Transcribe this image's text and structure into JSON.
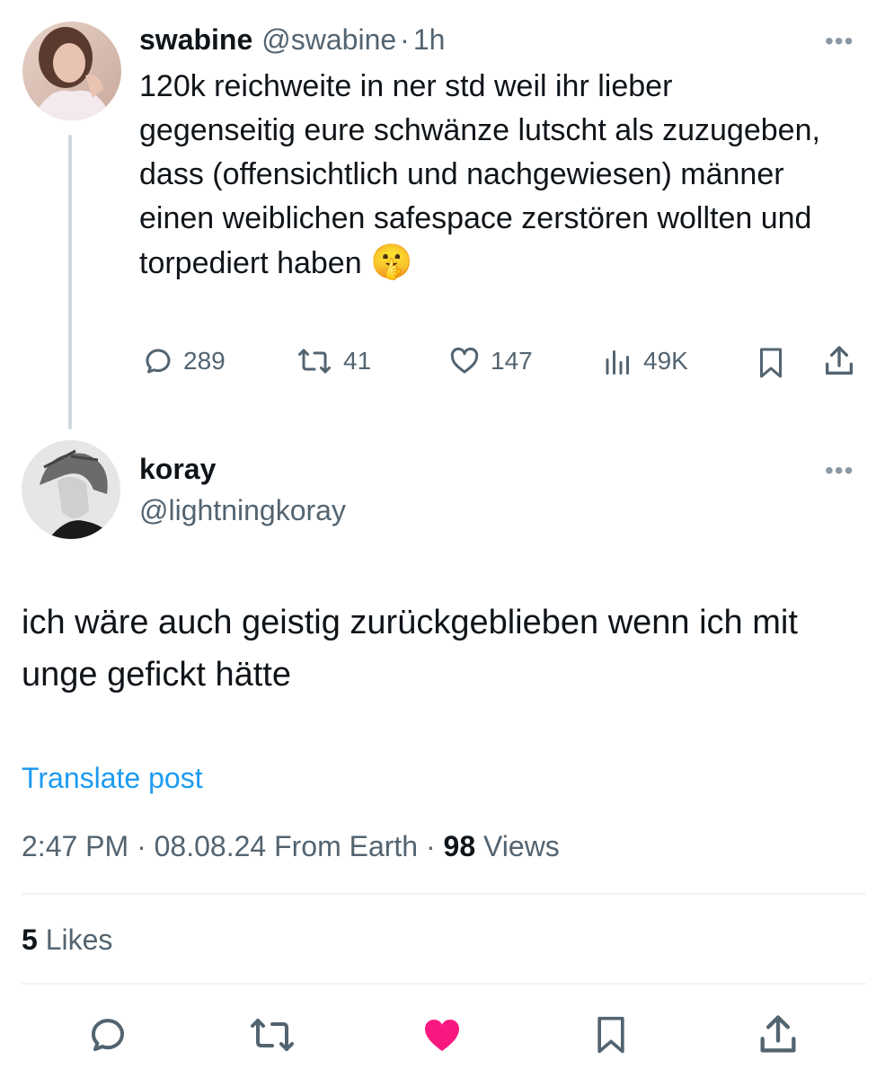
{
  "parent_tweet": {
    "name": "swabine",
    "handle": "@swabine",
    "separator": "·",
    "time": "1h",
    "text": "120k reichweite in ner std weil ihr lieber gegenseitig eure schwänze lutscht als zuzugeben, dass (offensichtlich und nachgewiesen) männer einen weiblichen safespace zerstören wollten und torpediert haben",
    "emoji": "🤫",
    "more": "•••",
    "stats": {
      "replies": "289",
      "reposts": "41",
      "likes": "147",
      "views": "49K"
    }
  },
  "reply_tweet": {
    "name": "koray",
    "handle": "@lightningkoray",
    "more": "•••",
    "text": "ich wäre auch geistig zurückgeblieben wenn ich mit unge gefickt hätte",
    "translate": "Translate post",
    "meta": {
      "time": "2:47 PM",
      "separator": "·",
      "date": "08.08.24",
      "source": "From Earth",
      "views_count": "98",
      "views_label": "Views"
    },
    "likes": {
      "count": "5",
      "label": "Likes"
    }
  },
  "colors": {
    "accent": "#1d9bf0",
    "like_active": "#f91880",
    "muted": "#536471",
    "divider": "#eff3f4"
  },
  "icons": [
    "reply-icon",
    "repost-icon",
    "like-icon",
    "views-icon",
    "bookmark-icon",
    "share-icon"
  ]
}
